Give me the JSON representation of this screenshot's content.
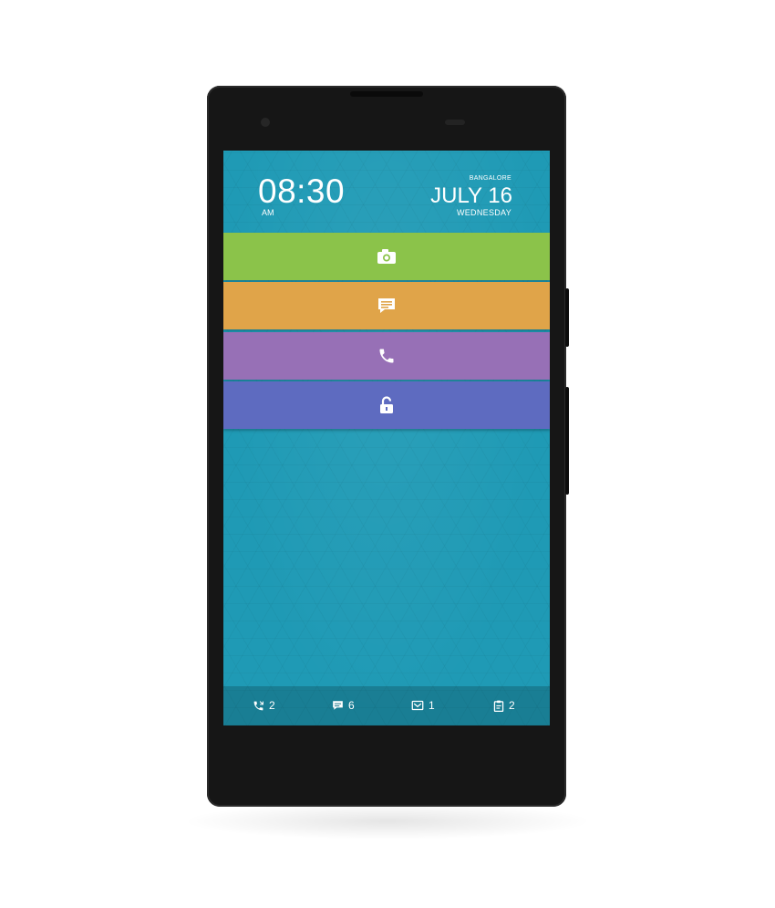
{
  "lockscreen": {
    "time": "08:30",
    "ampm": "AM",
    "city": "BANGALORE",
    "date": "JULY 16",
    "weekday": "WEDNESDAY"
  },
  "bands": [
    {
      "id": "camera",
      "icon": "camera-icon",
      "color": "#8bc34a"
    },
    {
      "id": "messages",
      "icon": "message-icon",
      "color": "#e0a449"
    },
    {
      "id": "phone",
      "icon": "phone-icon",
      "color": "#9770b6"
    },
    {
      "id": "unlock",
      "icon": "unlock-icon",
      "color": "#5e6bc0"
    }
  ],
  "status": {
    "missed_calls": "2",
    "messages": "6",
    "emails": "1",
    "tasks": "2"
  },
  "colors": {
    "screen_bg": "#1f9ab5",
    "phone_body": "#161616"
  }
}
